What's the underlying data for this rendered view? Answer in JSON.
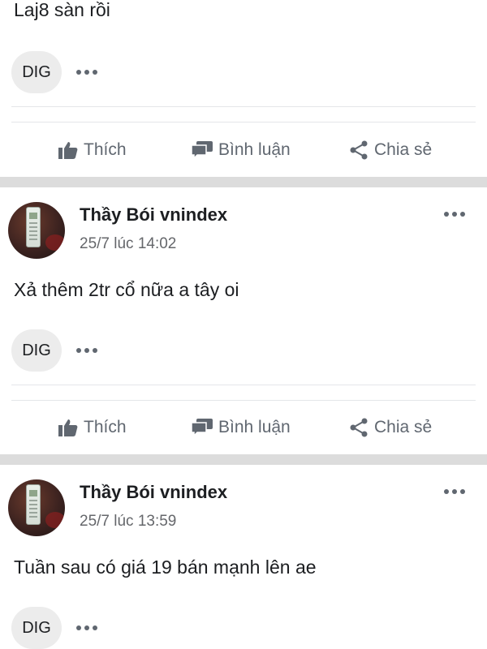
{
  "posts": [
    {
      "author": "",
      "timestamp": "",
      "text": "Laj8 sàn rồi",
      "reaction_badge": "DIG"
    },
    {
      "author": "Thầy Bói vnindex",
      "timestamp": "25/7 lúc 14:02",
      "text": "Xả thêm 2tr cổ nữa a tây oi",
      "reaction_badge": "DIG"
    },
    {
      "author": "Thầy Bói vnindex",
      "timestamp": "25/7 lúc 13:59",
      "text": "Tuần sau có giá 19 bán mạnh lên ae",
      "reaction_badge": "DIG"
    }
  ],
  "actions": {
    "like_label": "Thích",
    "comment_label": "Bình luận",
    "share_label": "Chia sẻ"
  },
  "icons": {
    "like": "thumbs-up-icon",
    "comment": "comment-icon",
    "share": "share-icon",
    "more": "more-dots-icon"
  },
  "colors": {
    "text": "#1c1e21",
    "muted": "#65676b",
    "action": "#606770",
    "separator": "#dcdcdc",
    "badge_bg": "#ececec"
  }
}
